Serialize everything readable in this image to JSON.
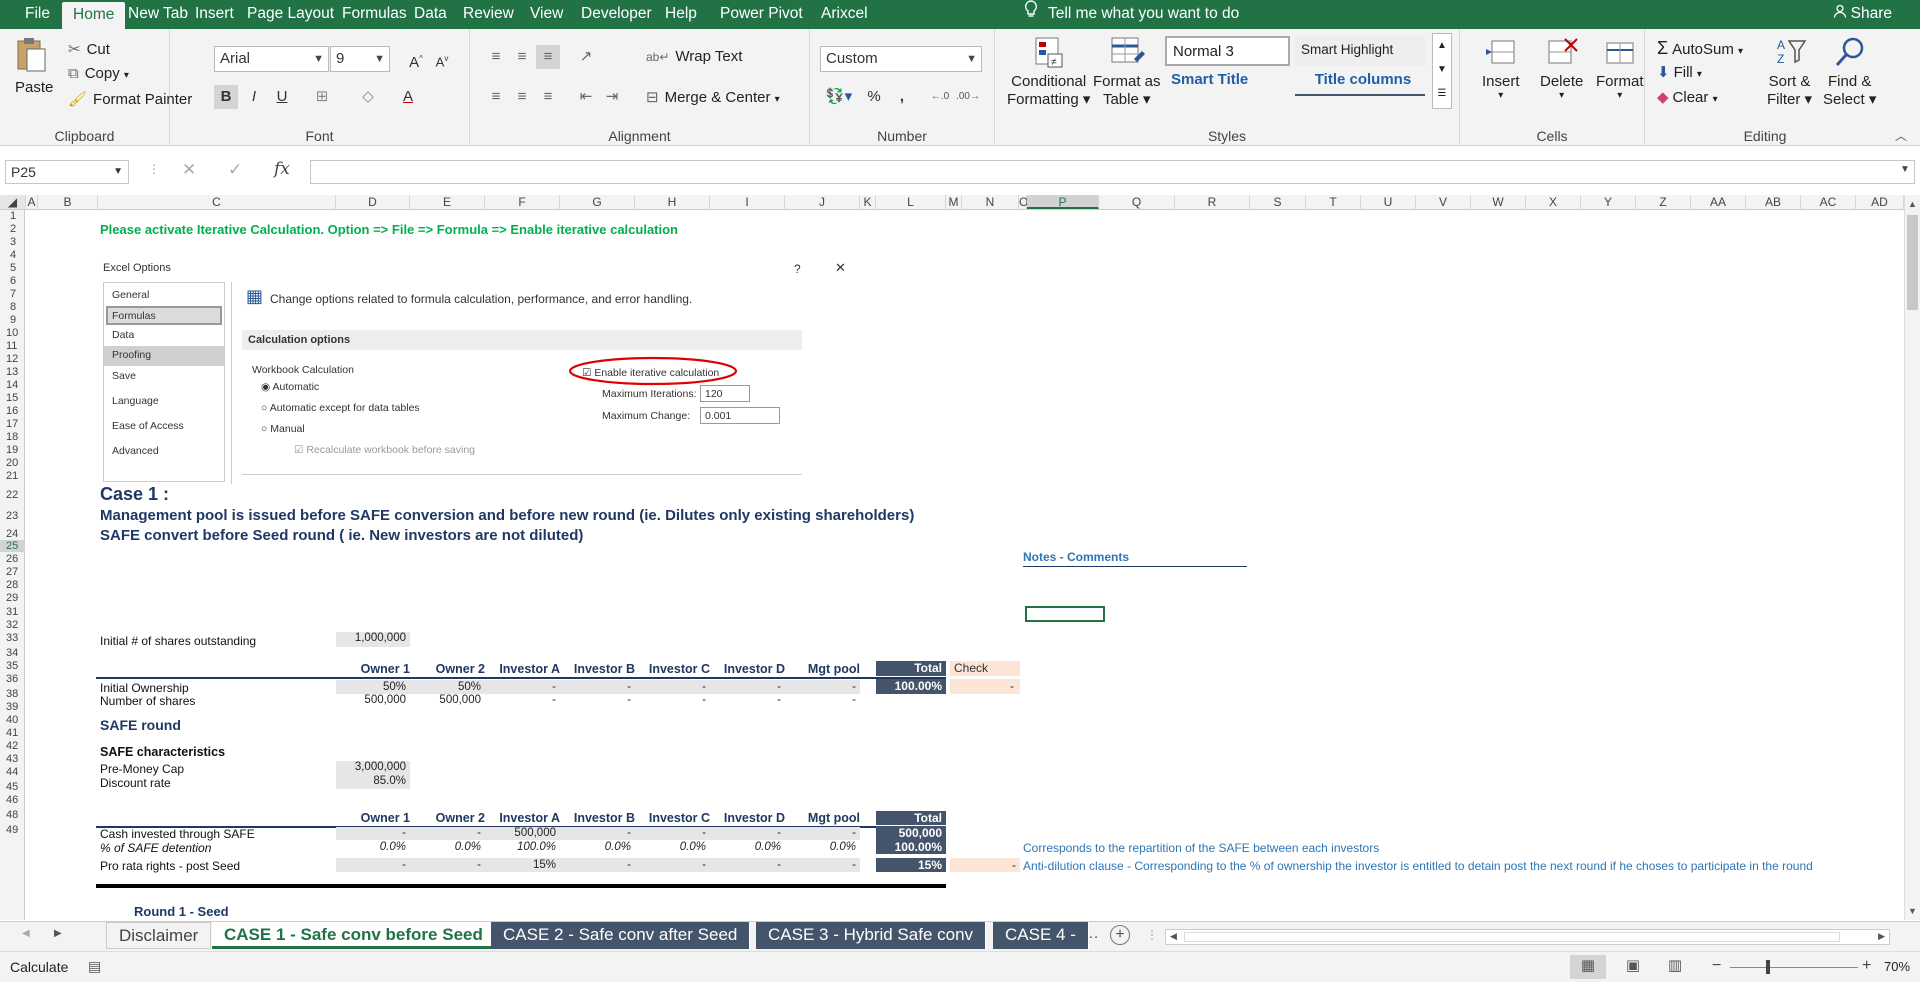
{
  "menu": {
    "tabs": [
      "File",
      "Home",
      "New Tab",
      "Insert",
      "Page Layout",
      "Formulas",
      "Data",
      "Review",
      "View",
      "Developer",
      "Help",
      "Power Pivot",
      "Arixcel"
    ],
    "tell_me": "Tell me what you want to do",
    "share": "Share"
  },
  "ribbon": {
    "clipboard": {
      "label": "Clipboard",
      "paste": "Paste",
      "cut": "Cut",
      "copy": "Copy",
      "format_painter": "Format Painter"
    },
    "font": {
      "label": "Font",
      "name": "Arial",
      "size": "9",
      "bold": "B",
      "italic": "I",
      "underline": "U"
    },
    "alignment": {
      "label": "Alignment",
      "wrap_text": "Wrap Text",
      "merge_center": "Merge & Center"
    },
    "number": {
      "label": "Number",
      "format": "Custom",
      "percent": "%",
      "comma": ","
    },
    "styles": {
      "label": "Styles",
      "conditional": "Conditional",
      "formatting": "Formatting",
      "format_as": "Format as",
      "table": "Table",
      "style1": "Normal 3",
      "style2": "Smart Highlight",
      "style3": "Smart Title",
      "style4": "Title columns"
    },
    "cells": {
      "label": "Cells",
      "insert": "Insert",
      "delete": "Delete",
      "format": "Format"
    },
    "editing": {
      "label": "Editing",
      "autosum": "AutoSum",
      "fill": "Fill",
      "clear": "Clear",
      "sort": "Sort &",
      "filter": "Filter",
      "find": "Find &",
      "select": "Select"
    }
  },
  "formula_bar": {
    "name_box": "P25",
    "fx": "fx",
    "value": ""
  },
  "columns": [
    "A",
    "B",
    "C",
    "D",
    "E",
    "F",
    "G",
    "H",
    "I",
    "J",
    "K",
    "L",
    "M",
    "N",
    "O",
    "P",
    "Q",
    "R",
    "S",
    "T",
    "U",
    "V",
    "W",
    "X",
    "Y",
    "Z",
    "AA",
    "AB",
    "AC",
    "AD"
  ],
  "rows": [
    "1",
    "2",
    "3",
    "4",
    "5",
    "6",
    "7",
    "8",
    "9",
    "10",
    "11",
    "12",
    "13",
    "14",
    "15",
    "16",
    "17",
    "18",
    "19",
    "20",
    "21",
    "22",
    "23",
    "24",
    "25",
    "26",
    "27",
    "28",
    "29",
    "31",
    "32",
    "33",
    "34",
    "35",
    "36",
    "38",
    "39",
    "40",
    "41",
    "42",
    "43",
    "44",
    "45",
    "46",
    "48",
    "49"
  ],
  "sheet": {
    "instruction": "Please activate Iterative Calculation. Option => File => Formula => Enable iterative calculation",
    "options_dialog": {
      "title": "Excel Options",
      "help": "?",
      "close": "✕",
      "nav": [
        "General",
        "Formulas",
        "Data",
        "Proofing",
        "Save",
        "Language",
        "Ease of Access",
        "Advanced"
      ],
      "heading": "Change options related to formula calculation, performance, and error handling.",
      "section": "Calculation options",
      "workbook_calc": "Workbook Calculation",
      "radio1": "Automatic",
      "radio2": "Automatic except for data tables",
      "radio3": "Manual",
      "recalc": "Recalculate workbook before saving",
      "enable_iter": "Enable iterative calculation",
      "max_iter_label": "Maximum Iterations:",
      "max_iter": "120",
      "max_change_label": "Maximum Change:",
      "max_change": "0.001"
    },
    "case_title": "Case 1 :",
    "case_line1": "Management pool is issued before SAFE conversion and before new round (ie. Dilutes only existing shareholders)",
    "case_line2": "SAFE convert before Seed round ( ie. New investors are not diluted)",
    "notes_title": "Notes - Comments",
    "initial_shares_label": "Initial # of shares outstanding",
    "initial_shares": "1,000,000",
    "headers": [
      "Owner 1",
      "Owner 2",
      "Investor A",
      "Investor B",
      "Investor C",
      "Investor D",
      "Mgt pool"
    ],
    "total": "Total",
    "check": "Check",
    "initial_ownership_label": "Initial Ownership",
    "initial_ownership": [
      "50%",
      "50%",
      "-",
      "-",
      "-",
      "-",
      "-"
    ],
    "initial_ownership_total": "100.00%",
    "initial_ownership_check": "-",
    "num_shares_label": "Number of shares",
    "num_shares": [
      "500,000",
      "500,000",
      "-",
      "-",
      "-",
      "-",
      "-"
    ],
    "safe_round": "SAFE round",
    "safe_char": "SAFE characteristics",
    "premoney_label": "Pre-Money Cap",
    "premoney": "3,000,000",
    "discount_label": "Discount rate",
    "discount": "85.0%",
    "cash_label": "Cash invested through SAFE",
    "cash": [
      "-",
      "-",
      "500,000",
      "-",
      "-",
      "-",
      "-"
    ],
    "cash_total": "500,000",
    "pct_safe_label": "% of SAFE detention",
    "pct_safe": [
      "0.0%",
      "0.0%",
      "100.0%",
      "0.0%",
      "0.0%",
      "0.0%",
      "0.0%"
    ],
    "pct_safe_total": "100.00%",
    "pct_safe_note": "Corresponds to the repartition of the SAFE between each investors",
    "prorata_label": "Pro rata rights - post Seed",
    "prorata": [
      "-",
      "-",
      "15%",
      "-",
      "-",
      "-",
      "-"
    ],
    "prorata_total": "15%",
    "prorata_check": "-",
    "prorata_note": "Anti-dilution clause - Corresponding to the % of ownership the investor is entitled to detain post the next round if he choses to participate in the round",
    "round1": "Round 1 - Seed"
  },
  "sheet_tabs": [
    "Disclaimer",
    "CASE 1 - Safe conv before Seed",
    "CASE 2 - Safe conv after Seed",
    "CASE 3 - Hybrid Safe conv",
    "CASE 4 -"
  ],
  "status": {
    "mode": "Calculate",
    "zoom": "70%"
  },
  "colors": {
    "excel_green": "#217346",
    "navy": "#44546a",
    "title_blue": "#1f3864",
    "note_blue": "#2e75b6",
    "instr_green": "#00b050"
  }
}
